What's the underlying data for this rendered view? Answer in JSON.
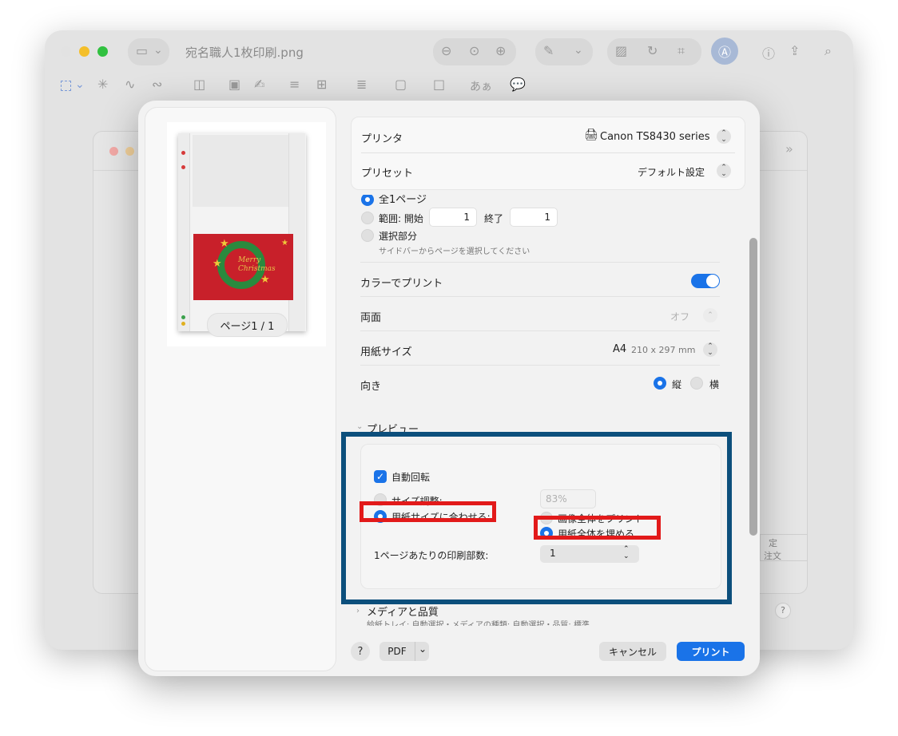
{
  "background_window": {
    "title": "宛名職人1枚印刷.png",
    "traffic_colors": [
      "#e2e2e2",
      "#f4bf2a",
      "#31c140"
    ],
    "inner_window_traffic_colors": [
      "#f3a9a6",
      "#f3d29c"
    ],
    "partial_texts": [
      "定",
      "注文"
    ],
    "chevron": "»",
    "help": "?"
  },
  "sidebar": {
    "card": {
      "text_line1": "Merry",
      "text_line2": "Christmas"
    },
    "page_indicator": "ページ1 / 1"
  },
  "printer": {
    "label": "プリンタ",
    "value": "Canon TS8430 series",
    "stepper_up": "⌃",
    "stepper_down": "⌄"
  },
  "preset": {
    "label": "プリセット",
    "value": "デフォルト設定"
  },
  "pages": {
    "all": "全1ページ",
    "range_label": "範囲: 開始",
    "range_from": "1",
    "range_to_label": "終了",
    "range_to": "1",
    "selection": "選択部分",
    "selection_hint": "サイドバーからページを選択してください"
  },
  "color_print": {
    "label": "カラーでプリント",
    "on": true
  },
  "duplex": {
    "label": "両面",
    "value": "オフ"
  },
  "paper_size": {
    "label": "用紙サイズ",
    "value": "A4",
    "detail": "210 x 297 mm"
  },
  "orientation": {
    "label": "向き",
    "portrait": "縦",
    "landscape": "横"
  },
  "preview_section": {
    "title": "プレビュー",
    "auto_rotate": "自動回転",
    "size_adjust": "サイズ調整:",
    "size_value": "83%",
    "fit_to_paper": "用紙サイズに合わせる:",
    "print_entire": "画像全体をプリント",
    "fill_entire": "用紙全体を埋める",
    "copies_per_page_label": "1ページあたりの印刷部数:",
    "copies_per_page_value": "1",
    "popup_chevron": "⌃⌄"
  },
  "media_section": {
    "title": "メディアと品質",
    "summary": "給紙トレイ: 自動選択・メディアの種類: 自動選択・品質: 標準"
  },
  "footer": {
    "help": "?",
    "pdf": "PDF",
    "pdf_chevron": "⌄",
    "cancel": "キャンセル",
    "print": "プリント"
  },
  "annotation_colors": {
    "blue_box": "#0c4f7c",
    "red_box": "#e21a1a"
  },
  "accent_color": "#1a73e8"
}
